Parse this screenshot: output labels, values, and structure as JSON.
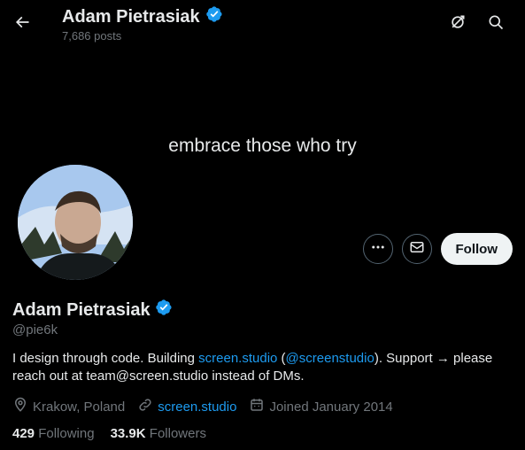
{
  "header": {
    "title": "Adam Pietrasiak",
    "posts": "7,686 posts"
  },
  "banner": {
    "text": "embrace those who try"
  },
  "actions": {
    "more_label": "•••",
    "follow_label": "Follow"
  },
  "profile": {
    "name": "Adam Pietrasiak",
    "handle": "@pie6k",
    "bio": {
      "part1": "I design through code. Building ",
      "link1": "screen.studio",
      "part2": " (",
      "link2": "@screenstudio",
      "part3": "). Support → please reach out at team@screen.studio instead of DMs."
    },
    "location": "Krakow, Poland",
    "website": "screen.studio",
    "joined": "Joined January 2014",
    "following_count": "429",
    "following_label": "Following",
    "followers_count": "33.9K",
    "followers_label": "Followers"
  },
  "icons": {
    "back": "arrow-left-icon",
    "verified": "verified-badge-icon",
    "subscribe": "alert-icon",
    "search": "search-icon",
    "more": "more-icon",
    "message": "mail-icon",
    "location": "location-icon",
    "link": "link-icon",
    "calendar": "calendar-icon"
  },
  "colors": {
    "background": "#000000",
    "text": "#e7e9ea",
    "muted": "#71767b",
    "accent": "#1d9bf0",
    "follow_bg": "#eff3f4"
  }
}
